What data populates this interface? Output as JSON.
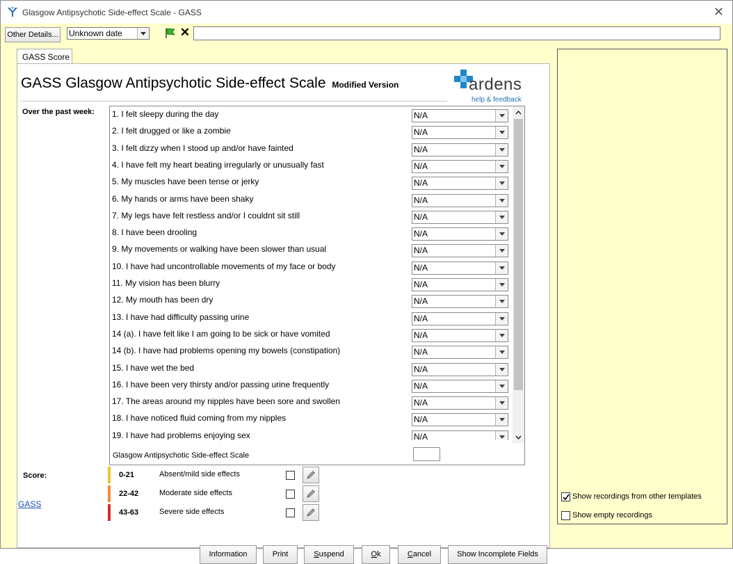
{
  "window": {
    "title": "Glasgow Antipsychotic Side-effect Scale - GASS",
    "close_glyph": "✕"
  },
  "toolbar": {
    "other_details": "Other Details...",
    "date_value": "Unknown date",
    "text_value": ""
  },
  "tab": {
    "label": "GASS Score"
  },
  "form": {
    "title": "GASS Glasgow Antipsychotic Side-effect Scale",
    "subtitle": "Modified Version",
    "past_week": "Over the past week:",
    "scale_label": "Glasgow Antipsychotic Side-effect Scale",
    "scale_value": ""
  },
  "logo": {
    "name": "ardens",
    "help": "help & feedback",
    "colors": {
      "cross": "#1f86c8",
      "text": "#3a3a3a"
    }
  },
  "questions": [
    {
      "text": "1. I felt sleepy during the day",
      "value": "N/A"
    },
    {
      "text": "2. I felt drugged or like a zombie",
      "value": "N/A"
    },
    {
      "text": "3. I felt dizzy when I stood up and/or have fainted",
      "value": "N/A"
    },
    {
      "text": "4. I have felt my heart beating irregularly or unusually fast",
      "value": "N/A"
    },
    {
      "text": "5. My muscles have been tense or jerky",
      "value": "N/A"
    },
    {
      "text": "6. My hands or arms have been shaky",
      "value": "N/A"
    },
    {
      "text": "7. My legs have felt restless and/or I couldnt sit still",
      "value": "N/A"
    },
    {
      "text": "8. I have been drooling",
      "value": "N/A"
    },
    {
      "text": "9. My movements or walking have been slower than usual",
      "value": "N/A"
    },
    {
      "text": "10. I have had uncontrollable movements of my face or body",
      "value": "N/A"
    },
    {
      "text": "11. My vision has been blurry",
      "value": "N/A"
    },
    {
      "text": "12. My mouth has been dry",
      "value": "N/A"
    },
    {
      "text": "13. I have had difficulty passing urine",
      "value": "N/A"
    },
    {
      "text": "14 (a). I have felt like I am going to be sick or have vomited",
      "value": "N/A"
    },
    {
      "text": "14 (b). I have had problems opening my bowels (constipation)",
      "value": "N/A"
    },
    {
      "text": "15. I have wet the bed",
      "value": "N/A"
    },
    {
      "text": "16. I have been very thirsty and/or passing urine frequently",
      "value": "N/A"
    },
    {
      "text": "17. The areas around my nipples have been sore and swollen",
      "value": "N/A"
    },
    {
      "text": "18. I have noticed fluid coming from my nipples",
      "value": "N/A"
    },
    {
      "text": "19. I have had problems enjoying sex",
      "value": "N/A"
    }
  ],
  "score": {
    "label": "Score:",
    "rows": [
      {
        "range": "0-21",
        "desc": "Absent/mild side effects",
        "color": "#f2c230",
        "checked": false
      },
      {
        "range": "22-42",
        "desc": "Moderate side effects",
        "color": "#ef8c3c",
        "checked": false
      },
      {
        "range": "43-63",
        "desc": "Severe side effects",
        "color": "#d62b2b",
        "checked": false
      }
    ]
  },
  "link": {
    "gass": "GASS"
  },
  "side": {
    "show_other": {
      "label": "Show recordings from other templates",
      "checked": true
    },
    "show_empty": {
      "label": "Show empty recordings",
      "checked": false
    }
  },
  "buttons": {
    "information": "Information",
    "print": "Print",
    "suspend_first": "S",
    "suspend_rest": "uspend",
    "ok_first": "O",
    "ok_rest": "k",
    "cancel_first": "C",
    "cancel_rest": "ancel",
    "show_incomplete": "Show Incomplete Fields"
  }
}
